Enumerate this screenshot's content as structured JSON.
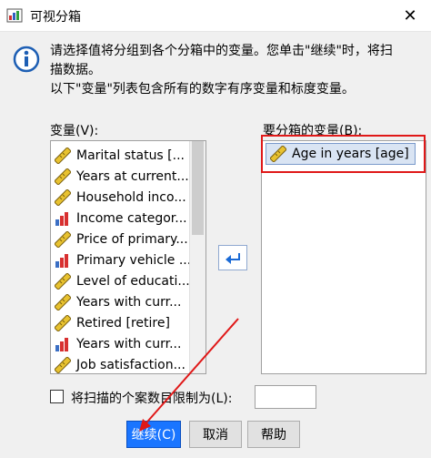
{
  "window": {
    "title": "可视分箱",
    "close_glyph": "✕"
  },
  "info": {
    "lines": [
      "请选择值将分组到各个分箱中的变量。您单击\"继续\"时，将扫",
      "描数据。",
      "以下\"变量\"列表包含所有的数字有序变量和标度变量。"
    ]
  },
  "variables": {
    "label": "变量(V):",
    "items": [
      {
        "label": "Marital status [...",
        "icon": "ruler-icon"
      },
      {
        "label": "Years at current...",
        "icon": "ruler-icon"
      },
      {
        "label": "Household inco...",
        "icon": "ruler-icon"
      },
      {
        "label": "Income categor...",
        "icon": "ordinal-bar-icon"
      },
      {
        "label": "Price of primary...",
        "icon": "ruler-icon"
      },
      {
        "label": "Primary vehicle ...",
        "icon": "ordinal-bar-icon"
      },
      {
        "label": "Level of educati...",
        "icon": "ruler-icon"
      },
      {
        "label": "Years with curr...",
        "icon": "ruler-icon"
      },
      {
        "label": "Retired [retire]",
        "icon": "ruler-icon"
      },
      {
        "label": "Years with curr...",
        "icon": "ordinal-bar-icon"
      },
      {
        "label": "Job satisfaction...",
        "icon": "ruler-icon"
      }
    ]
  },
  "target": {
    "label": "要分箱的变量(B):",
    "items": [
      {
        "label": "Age in years [age]",
        "icon": "ruler-icon"
      }
    ]
  },
  "limit": {
    "label": "将扫描的个案数目限制为(L):",
    "value": ""
  },
  "buttons": {
    "continue": "继续(C)",
    "cancel": "取消",
    "help": "帮助"
  },
  "colors": {
    "accent": "#1a75ff",
    "highlight": "#e01818",
    "selection": "#d9e4f3"
  }
}
